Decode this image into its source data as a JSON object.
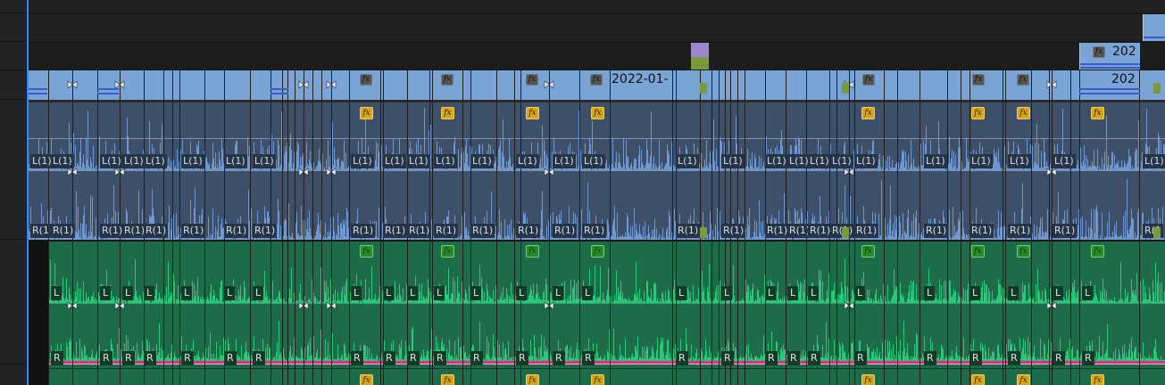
{
  "timeline": {
    "video_clip_label": "2022-01-",
    "short_clip_label": "202",
    "audio_channel_left": "L(1)",
    "audio_channel_right": "R(1)",
    "audio_channel_right_cut": "R(1",
    "green_left": "L",
    "green_right": "R",
    "fx_badge": "fx"
  },
  "colors": {
    "video_clip": "#7aa3d6",
    "audio_blue": "#3e4f6a",
    "audio_green": "#1d6b48",
    "waveform_blue": "#6f98d1",
    "waveform_green": "#27c87a",
    "volume_line": "#e22d86",
    "playhead": "#2c8cff"
  }
}
